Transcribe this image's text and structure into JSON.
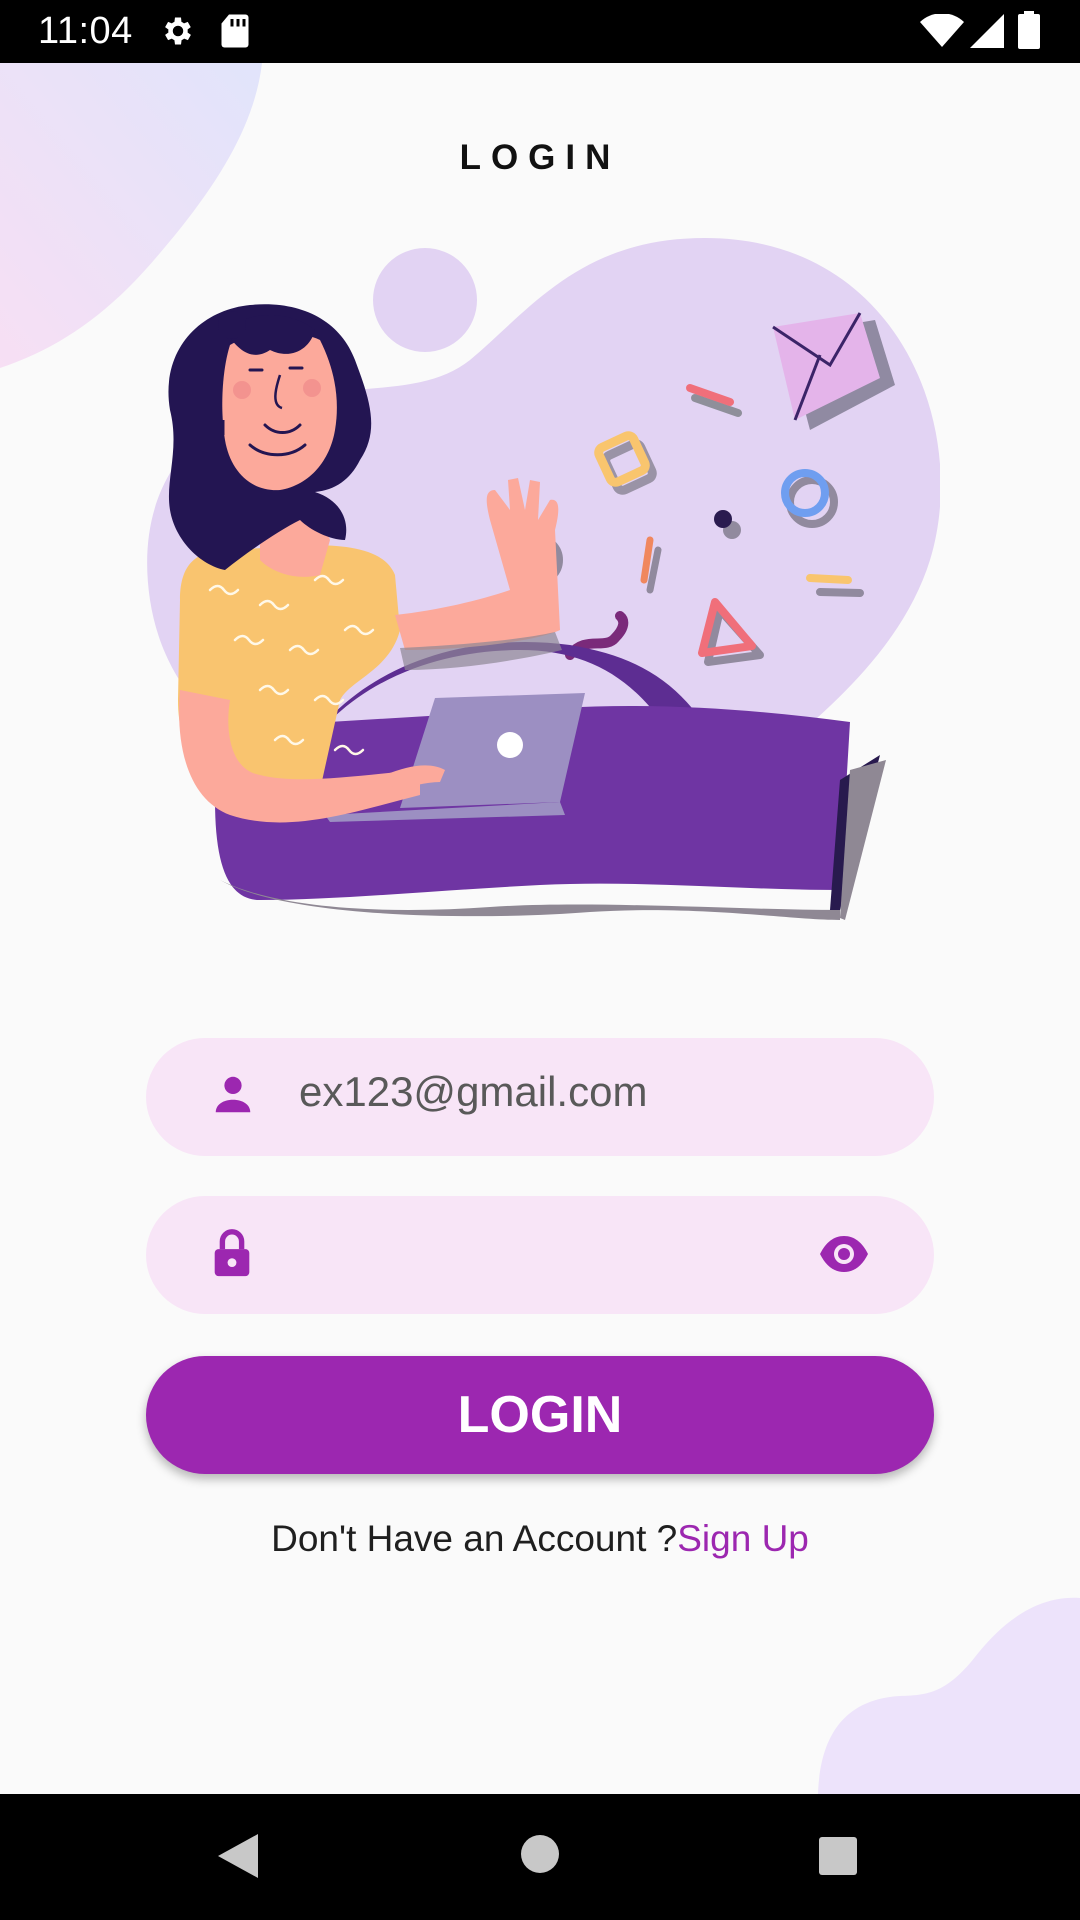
{
  "status_bar": {
    "time": "11:04",
    "icons": [
      "settings-icon",
      "sd-card-icon",
      "wifi-icon",
      "cellular-signal-icon",
      "battery-icon"
    ]
  },
  "page": {
    "title": "LOGIN"
  },
  "form": {
    "email": {
      "icon": "person-icon",
      "value": "ex123@gmail.com",
      "placeholder": ""
    },
    "password": {
      "icon": "lock-icon",
      "value": "",
      "toggle_icon": "eye-icon"
    },
    "login_button_label": "LOGIN",
    "signup_prompt": "Don't Have an Account ?",
    "signup_link": "Sign Up"
  },
  "nav_bar": {
    "buttons": [
      "back-triangle-icon",
      "home-circle-icon",
      "recents-square-icon"
    ]
  },
  "colors": {
    "accent": "#9c27b0",
    "field_background": "#f8e5f7",
    "page_background": "#fafafa",
    "illustration_lavender": "#e2d3f3",
    "illustration_purple": "#6f35a3"
  }
}
